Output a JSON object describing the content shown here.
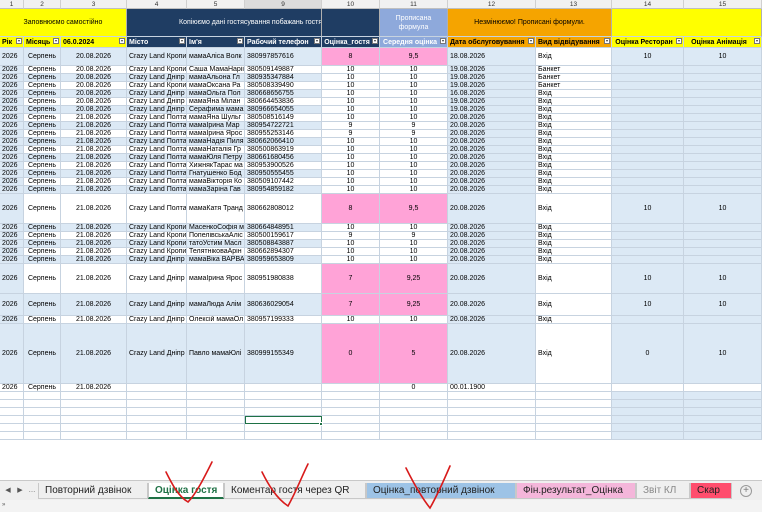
{
  "colors": {
    "yellow": "#ffff00",
    "navy": "#1f3d63",
    "periwinkle": "#8ea9db",
    "orange": "#f5a400",
    "pink": "#ffa3d7",
    "lightblue": "#dce9f5",
    "excel_green": "#1e7145"
  },
  "column_numbers": [
    "1",
    "2",
    "3",
    "4",
    "5",
    "9",
    "10",
    "11",
    "12",
    "13",
    "14",
    "15"
  ],
  "bands": {
    "fill_yourself": "Заповнюємо самостійно",
    "copy_guest_data": "Копіюємо дані гостя",
    "copy_tail": "сування побажань гостя",
    "formula_l1": "Прописана",
    "formula_l2": "формула",
    "dont_change": "Незмінюємо! Прописані формули."
  },
  "headers": [
    "Рік",
    "Місяць",
    "06.0.2024",
    "Місто",
    "Ім'я",
    "Рабочий телефон",
    "Оцінка_гостя",
    "Середня оцінка",
    "Дата обслуговування",
    "Вид відвідування",
    "Оцінка Ресторан",
    "Оцінка Анімація"
  ],
  "rows": [
    [
      "2026",
      "Серпень",
      "20.08.2026",
      "Crazy Land Кропи",
      "мамаАліса Волк",
      "380997857616",
      "8",
      "9,5",
      "18.08.2026",
      "Вхід",
      "10",
      "10"
    ],
    [
      "2026",
      "Серпень",
      "20.08.2026",
      "Crazy Land Кропи",
      "Саша МамаНаріі",
      "380509149887",
      "10",
      "10",
      "19.08.2026",
      "Банкет",
      "",
      ""
    ],
    [
      "2026",
      "Серпень",
      "20.08.2026",
      "Crazy Land Дніпр",
      "мамаАльона Гл",
      "380935347884",
      "10",
      "10",
      "19.08.2026",
      "Банкет",
      "",
      ""
    ],
    [
      "2026",
      "Серпень",
      "20.08.2026",
      "Crazy Land Кропи",
      "мамаОксана Ра",
      "380508339490",
      "10",
      "10",
      "19.08.2026",
      "Банкет",
      "",
      ""
    ],
    [
      "2026",
      "Серпень",
      "20.08.2026",
      "Crazy Land Дніпр",
      "мамаОльга Пол",
      "380668656755",
      "10",
      "10",
      "16.08.2026",
      "Вхід",
      "",
      ""
    ],
    [
      "2026",
      "Серпень",
      "20.08.2026",
      "Crazy Land Дніпр",
      "мамаЯна Мілан",
      "380664453836",
      "10",
      "10",
      "19.08.2026",
      "Вхід",
      "",
      ""
    ],
    [
      "2026",
      "Серпень",
      "20.08.2026",
      "Crazy Land Дніпр",
      "Серафима мама",
      "380966654055",
      "10",
      "10",
      "19.08.2026",
      "Вхід",
      "",
      ""
    ],
    [
      "2026",
      "Серпень",
      "21.08.2026",
      "Crazy Land Полта",
      "мамаЯна Шульг",
      "380508516149",
      "10",
      "10",
      "20.08.2026",
      "Вхід",
      "",
      ""
    ],
    [
      "2026",
      "Серпень",
      "21.08.2026",
      "Crazy Land Полта",
      "мамаІрина Мар",
      "380954722721",
      "9",
      "9",
      "20.08.2026",
      "Вхід",
      "",
      ""
    ],
    [
      "2026",
      "Серпень",
      "21.08.2026",
      "Crazy Land Полта",
      "мамаІрина Ярос",
      "380955253146",
      "9",
      "9",
      "20.08.2026",
      "Вхід",
      "",
      ""
    ],
    [
      "2026",
      "Серпень",
      "21.08.2026",
      "Crazy Land Полта",
      "мамаНадія Пиля",
      "380662066410",
      "10",
      "10",
      "20.08.2026",
      "Вхід",
      "",
      ""
    ],
    [
      "2026",
      "Серпень",
      "21.08.2026",
      "Crazy Land Полта",
      "мамаНаталія Гр",
      "380500863919",
      "10",
      "10",
      "20.08.2026",
      "Вхід",
      "",
      ""
    ],
    [
      "2026",
      "Серпень",
      "21.08.2026",
      "Crazy Land Полта",
      "мамаЮля Петру",
      "380661680456",
      "10",
      "10",
      "20.08.2026",
      "Вхід",
      "",
      ""
    ],
    [
      "2026",
      "Серпень",
      "21.08.2026",
      "Crazy Land Полта",
      "ХижнякТарас ма",
      "380953900526",
      "10",
      "10",
      "20.08.2026",
      "Вхід",
      "",
      ""
    ],
    [
      "2026",
      "Серпень",
      "21.08.2026",
      "Crazy Land Полта",
      "Гнатушенко Бод",
      "380950555455",
      "10",
      "10",
      "20.08.2026",
      "Вхід",
      "",
      ""
    ],
    [
      "2026",
      "Серпень",
      "21.08.2026",
      "Crazy Land Полта",
      "мамаВікторія Ко",
      "380509107442",
      "10",
      "10",
      "20.08.2026",
      "Вхід",
      "",
      ""
    ],
    [
      "2026",
      "Серпень",
      "21.08.2026",
      "Crazy Land Полта",
      "мамаЗаріна Гав",
      "380954859182",
      "10",
      "10",
      "20.08.2026",
      "Вхід",
      "",
      ""
    ],
    [
      "2026",
      "Серпень",
      "21.08.2026",
      "Crazy Land Полта",
      "мамаКатя Транд",
      "380662808012",
      "8",
      "9,5",
      "20.08.2026",
      "Вхід",
      "10",
      "10"
    ],
    [
      "2026",
      "Серпень",
      "21.08.2026",
      "Crazy Land Кропи",
      "МасенкоСофія м",
      "380664848951",
      "10",
      "10",
      "20.08.2026",
      "Вхід",
      "",
      ""
    ],
    [
      "2026",
      "Серпень",
      "21.08.2026",
      "Crazy Land Кропи",
      "ПопелівськаАліс",
      "380500159617",
      "9",
      "9",
      "20.08.2026",
      "Вхід",
      "",
      ""
    ],
    [
      "2026",
      "Серпень",
      "21.08.2026",
      "Crazy Land Кропи",
      "татоУстим Масл",
      "380508843887",
      "10",
      "10",
      "20.08.2026",
      "Вхід",
      "",
      ""
    ],
    [
      "2026",
      "Серпень",
      "21.08.2026",
      "Crazy Land Кропи",
      "ТелятніковаАрін",
      "380662894307",
      "10",
      "10",
      "20.08.2026",
      "Вхід",
      "",
      ""
    ],
    [
      "2026",
      "Серпень",
      "21.08.2026",
      "Crazy Land Дніпр",
      "мамаВіка ВАРВА",
      "380959653809",
      "10",
      "10",
      "20.08.2026",
      "Вхід",
      "",
      ""
    ],
    [
      "2026",
      "Серпень",
      "21.08.2026",
      "Crazy Land Дніпр",
      "мамаІрина Ярос",
      "380951980838",
      "7",
      "9,25",
      "20.08.2026",
      "Вхід",
      "10",
      "10"
    ],
    [
      "2026",
      "Серпень",
      "21.08.2026",
      "Crazy Land Дніпр",
      "мамаЛюда Алім",
      "380636029054",
      "7",
      "9,25",
      "20.08.2026",
      "Вхід",
      "10",
      "10"
    ],
    [
      "2026",
      "Серпень",
      "21.08.2026",
      "Crazy Land Дніпр",
      "Олексій мамаОл",
      "380957199333",
      "10",
      "10",
      "20.08.2026",
      "Вхід",
      "",
      ""
    ],
    [
      "2026",
      "Серпень",
      "21.08.2026",
      "Crazy Land Дніпр",
      "Павло мамаЮлі",
      "380999155349",
      "0",
      "5",
      "20.08.2026",
      "Вхід",
      "0",
      "10"
    ],
    [
      "2026",
      "Серпень",
      "21.08.2026",
      "",
      "",
      "",
      "",
      "0",
      "00.01.1900",
      "",
      "",
      ""
    ]
  ],
  "tabs": [
    "Повторний дзвінок",
    "Оцінка гостя",
    "Коментар гостя через QR",
    "Оцінка_повторний дзвінок",
    "Фін.результат_Оцінка",
    "Звіт КЛ",
    "Скар"
  ],
  "active_tab": "Оцінка гостя",
  "status": "»"
}
